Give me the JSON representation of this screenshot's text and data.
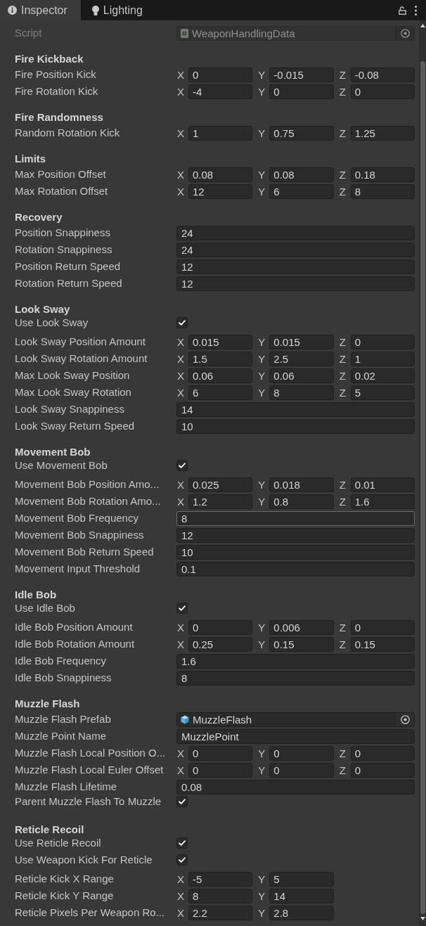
{
  "tabs": [
    {
      "label": "Inspector",
      "selected": true
    },
    {
      "label": "Lighting",
      "selected": false
    }
  ],
  "script": {
    "label": "Script",
    "value": "WeaponHandlingData",
    "disabled": true
  },
  "sections": [
    {
      "title": "Fire Kickback",
      "rows": [
        {
          "kind": "vector",
          "label": "Fire Position Kick",
          "hovered": false,
          "components": [
            {
              "axis": "X",
              "value": "0"
            },
            {
              "axis": "Y",
              "value": "-0.015"
            },
            {
              "axis": "Z",
              "value": "-0.08"
            }
          ]
        },
        {
          "kind": "vector",
          "label": "Fire Rotation Kick",
          "hovered": false,
          "components": [
            {
              "axis": "X",
              "value": "-4"
            },
            {
              "axis": "Y",
              "value": "0"
            },
            {
              "axis": "Z",
              "value": "0"
            }
          ]
        }
      ]
    },
    {
      "title": "Fire Randomness",
      "rows": [
        {
          "kind": "vector",
          "label": "Random Rotation Kick",
          "hovered": false,
          "components": [
            {
              "axis": "X",
              "value": "1"
            },
            {
              "axis": "Y",
              "value": "0.75"
            },
            {
              "axis": "Z",
              "value": "1.25"
            }
          ]
        }
      ]
    },
    {
      "title": "Limits",
      "rows": [
        {
          "kind": "vector",
          "label": "Max Position Offset",
          "hovered": false,
          "components": [
            {
              "axis": "X",
              "value": "0.08"
            },
            {
              "axis": "Y",
              "value": "0.08"
            },
            {
              "axis": "Z",
              "value": "0.18"
            }
          ]
        },
        {
          "kind": "vector",
          "label": "Max Rotation Offset",
          "hovered": false,
          "components": [
            {
              "axis": "X",
              "value": "12"
            },
            {
              "axis": "Y",
              "value": "6"
            },
            {
              "axis": "Z",
              "value": "8"
            }
          ]
        }
      ]
    },
    {
      "title": "Recovery",
      "rows": [
        {
          "kind": "float",
          "label": "Position Snappiness",
          "value": "24",
          "hovered": false
        },
        {
          "kind": "float",
          "label": "Rotation Snappiness",
          "value": "24",
          "hovered": false
        },
        {
          "kind": "float",
          "label": "Position Return Speed",
          "value": "12",
          "hovered": false
        },
        {
          "kind": "float",
          "label": "Rotation Return Speed",
          "value": "12",
          "hovered": false
        }
      ]
    },
    {
      "title": "Look Sway",
      "rows": [
        {
          "kind": "toggle",
          "label": "Use Look Sway",
          "checked": true
        },
        {
          "kind": "vector",
          "label": "Look Sway Position Amount",
          "hovered": false,
          "components": [
            {
              "axis": "X",
              "value": "0.015"
            },
            {
              "axis": "Y",
              "value": "0.015"
            },
            {
              "axis": "Z",
              "value": "0"
            }
          ]
        },
        {
          "kind": "vector",
          "label": "Look Sway Rotation Amount",
          "hovered": false,
          "components": [
            {
              "axis": "X",
              "value": "1.5"
            },
            {
              "axis": "Y",
              "value": "2.5"
            },
            {
              "axis": "Z",
              "value": "1"
            }
          ]
        },
        {
          "kind": "vector",
          "label": "Max Look Sway Position",
          "hovered": false,
          "components": [
            {
              "axis": "X",
              "value": "0.06"
            },
            {
              "axis": "Y",
              "value": "0.06"
            },
            {
              "axis": "Z",
              "value": "0.02"
            }
          ]
        },
        {
          "kind": "vector",
          "label": "Max Look Sway Rotation",
          "hovered": false,
          "components": [
            {
              "axis": "X",
              "value": "6"
            },
            {
              "axis": "Y",
              "value": "8"
            },
            {
              "axis": "Z",
              "value": "5"
            }
          ]
        },
        {
          "kind": "float",
          "label": "Look Sway Snappiness",
          "value": "14",
          "hovered": false
        },
        {
          "kind": "float",
          "label": "Look Sway Return Speed",
          "value": "10",
          "hovered": false
        }
      ]
    },
    {
      "title": "Movement Bob",
      "rows": [
        {
          "kind": "toggle",
          "label": "Use Movement Bob",
          "checked": true
        },
        {
          "kind": "vector",
          "label": "Movement Bob Position Amo...",
          "hovered": false,
          "components": [
            {
              "axis": "X",
              "value": "0.025"
            },
            {
              "axis": "Y",
              "value": "0.018"
            },
            {
              "axis": "Z",
              "value": "0.01"
            }
          ]
        },
        {
          "kind": "vector",
          "label": "Movement Bob Rotation Amo...",
          "hovered": false,
          "components": [
            {
              "axis": "X",
              "value": "1.2"
            },
            {
              "axis": "Y",
              "value": "0.8"
            },
            {
              "axis": "Z",
              "value": "1.6"
            }
          ]
        },
        {
          "kind": "float",
          "label": "Movement Bob Frequency",
          "value": "8",
          "hovered": true
        },
        {
          "kind": "float",
          "label": "Movement Bob Snappiness",
          "value": "12",
          "hovered": false
        },
        {
          "kind": "float",
          "label": "Movement Bob Return Speed",
          "value": "10",
          "hovered": false
        },
        {
          "kind": "float",
          "label": "Movement Input Threshold",
          "value": "0.1",
          "hovered": false
        }
      ]
    },
    {
      "title": "Idle Bob",
      "rows": [
        {
          "kind": "toggle",
          "label": "Use Idle Bob",
          "checked": true
        },
        {
          "kind": "vector",
          "label": "Idle Bob Position Amount",
          "hovered": false,
          "components": [
            {
              "axis": "X",
              "value": "0"
            },
            {
              "axis": "Y",
              "value": "0.006"
            },
            {
              "axis": "Z",
              "value": "0"
            }
          ]
        },
        {
          "kind": "vector",
          "label": "Idle Bob Rotation Amount",
          "hovered": false,
          "components": [
            {
              "axis": "X",
              "value": "0.25"
            },
            {
              "axis": "Y",
              "value": "0.15"
            },
            {
              "axis": "Z",
              "value": "0.15"
            }
          ]
        },
        {
          "kind": "float",
          "label": "Idle Bob Frequency",
          "value": "1.6",
          "hovered": false
        },
        {
          "kind": "float",
          "label": "Idle Bob Snappiness",
          "value": "8",
          "hovered": false
        }
      ]
    },
    {
      "title": "Muzzle Flash",
      "rows": [
        {
          "kind": "object",
          "label": "Muzzle Flash Prefab",
          "value": "MuzzleFlash",
          "hovered": false
        },
        {
          "kind": "text",
          "label": "Muzzle Point Name",
          "value": "MuzzlePoint",
          "hovered": false
        },
        {
          "kind": "vector",
          "label": "Muzzle Flash Local Position O...",
          "hovered": false,
          "components": [
            {
              "axis": "X",
              "value": "0"
            },
            {
              "axis": "Y",
              "value": "0"
            },
            {
              "axis": "Z",
              "value": "0"
            }
          ]
        },
        {
          "kind": "vector",
          "label": "Muzzle Flash Local Euler Offset",
          "hovered": false,
          "components": [
            {
              "axis": "X",
              "value": "0"
            },
            {
              "axis": "Y",
              "value": "0"
            },
            {
              "axis": "Z",
              "value": "0"
            }
          ]
        },
        {
          "kind": "float",
          "label": "Muzzle Flash Lifetime",
          "value": "0.08",
          "hovered": false
        },
        {
          "kind": "toggle",
          "label": "Parent Muzzle Flash To Muzzle",
          "checked": true
        }
      ]
    },
    {
      "title": "Reticle Recoil",
      "rows": [
        {
          "kind": "toggle",
          "label": "Use Reticle Recoil",
          "checked": true
        },
        {
          "kind": "toggle",
          "label": "Use Weapon Kick For Reticle",
          "checked": true
        },
        {
          "kind": "vector",
          "label": "Reticle Kick X Range",
          "hovered": false,
          "components": [
            {
              "axis": "X",
              "value": "-5"
            },
            {
              "axis": "Y",
              "value": "5"
            }
          ]
        },
        {
          "kind": "vector",
          "label": "Reticle Kick Y Range",
          "hovered": false,
          "components": [
            {
              "axis": "X",
              "value": "8"
            },
            {
              "axis": "Y",
              "value": "14"
            }
          ]
        },
        {
          "kind": "vector",
          "label": "Reticle Pixels Per Weapon Ro...",
          "hovered": false,
          "components": [
            {
              "axis": "X",
              "value": "2.2"
            },
            {
              "axis": "Y",
              "value": "2.8"
            }
          ]
        }
      ]
    }
  ]
}
